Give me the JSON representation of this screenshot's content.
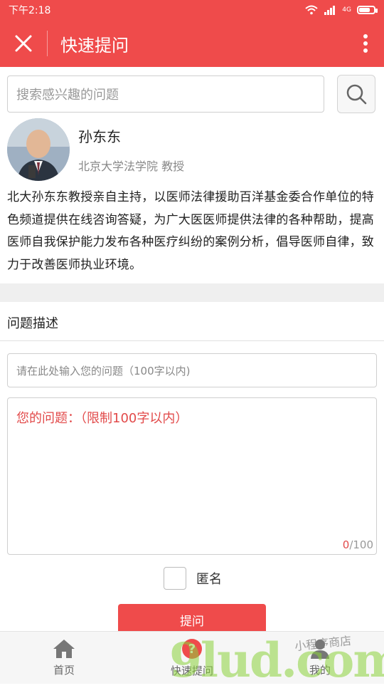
{
  "status_bar": {
    "time": "下午2:18",
    "network": "4G"
  },
  "header": {
    "title": "快速提问"
  },
  "search": {
    "placeholder": "搜索感兴趣的问题"
  },
  "expert": {
    "name": "孙东东",
    "affiliation": "北京大学法学院 教授"
  },
  "intro": "北大孙东东教授亲自主持，以医师法律援助百洋基金委合作单位的特色频道提供在线咨询答疑，为广大医医师提供法律的各种帮助，提高医师自我保护能力发布各种医疗纠纷的案例分析，倡导医师自律，致力于改善医师执业环境。",
  "form": {
    "section_title": "问题描述",
    "title_placeholder": "请在此处输入您的问题（100字以内)",
    "body_placeholder": "您的问题：（限制100字以内）",
    "char_count": "0",
    "char_limit": "/100",
    "anonymous_label": "匿名",
    "submit_label": "提问"
  },
  "tabs": [
    {
      "label": "首页",
      "icon": "home-icon"
    },
    {
      "label": "快速提问",
      "icon": "question-icon"
    },
    {
      "label": "我的",
      "icon": "user-icon"
    }
  ],
  "watermark": {
    "text": "9lud.com",
    "small": "小程序商店"
  },
  "colors": {
    "brand": "#ef4b4b",
    "placeholder_red": "#e24a4a"
  }
}
